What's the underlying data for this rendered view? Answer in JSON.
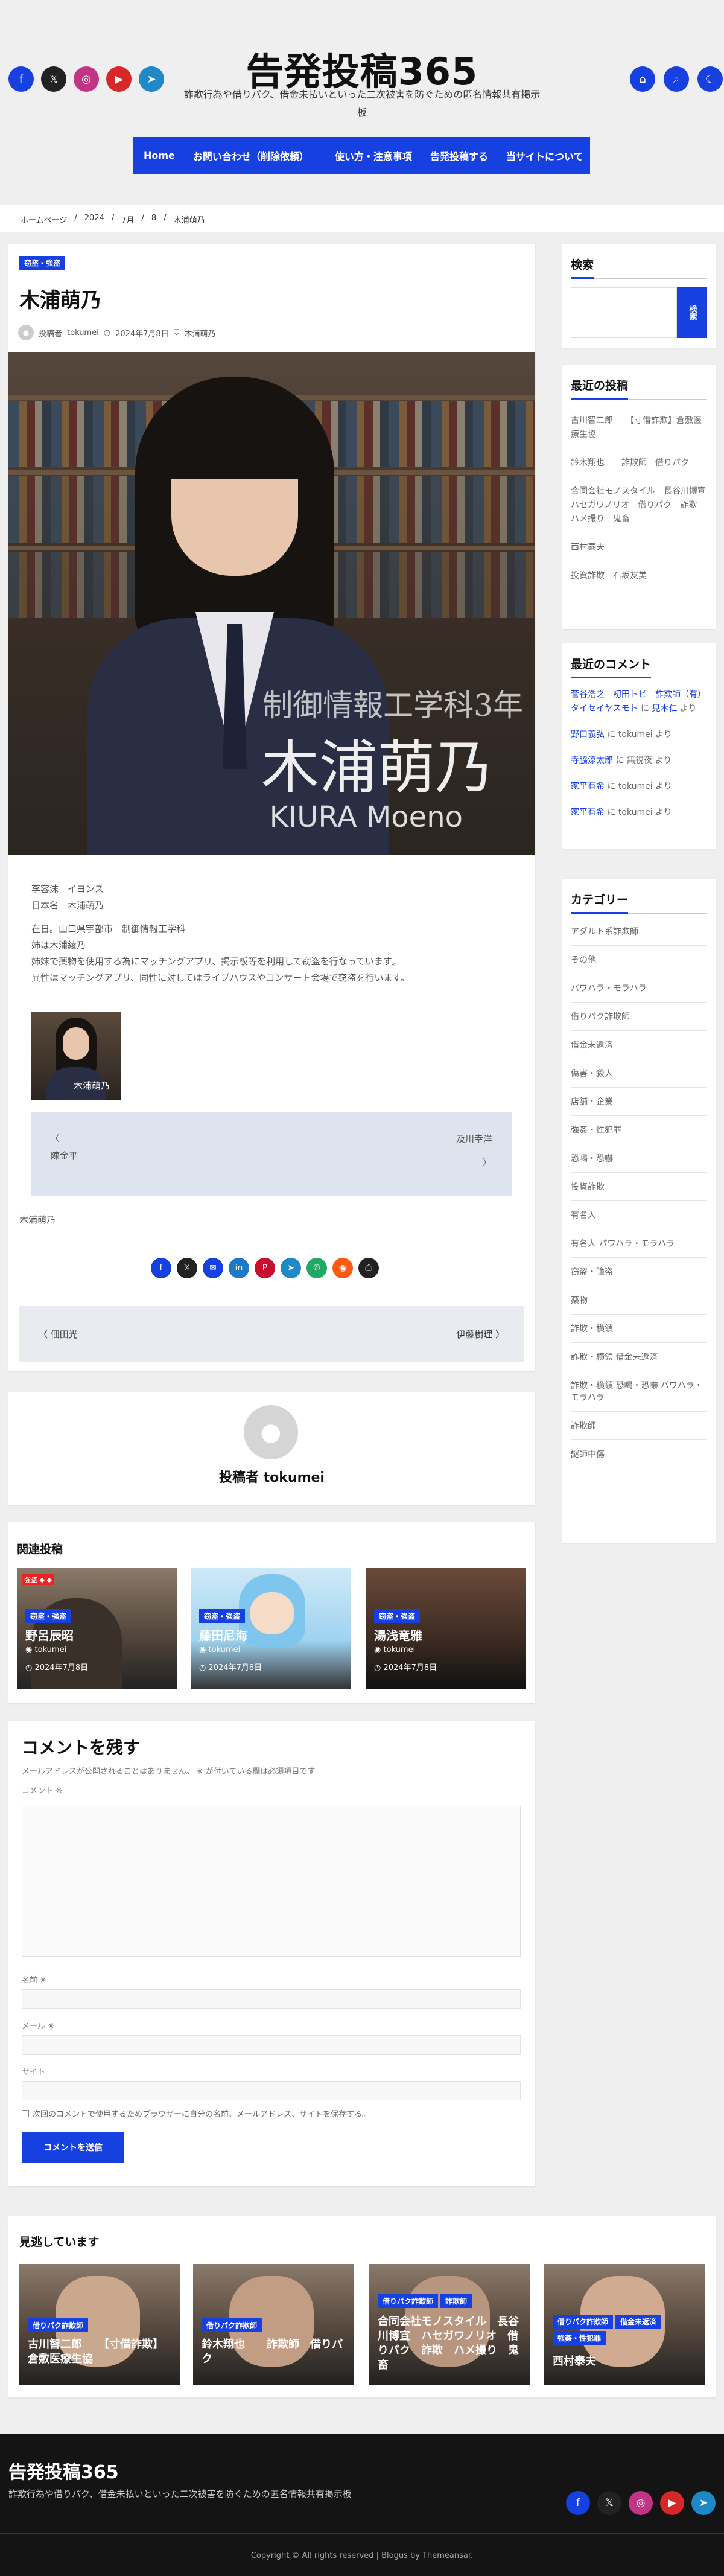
{
  "header": {
    "site_title": "告発投稿365",
    "site_description": "詐欺行為や借りパク、借金未払いといった二次被害を防ぐための匿名情報共有掲示板",
    "social_left": [
      {
        "icon": "facebook-icon",
        "glyph": "f",
        "color": "#1740e0"
      },
      {
        "icon": "x-icon",
        "glyph": "𝕏",
        "color": "#222222"
      },
      {
        "icon": "instagram-icon",
        "glyph": "◎",
        "color": "#c13584"
      },
      {
        "icon": "youtube-icon",
        "glyph": "▶",
        "color": "#d62828"
      },
      {
        "icon": "telegram-icon",
        "glyph": "➤",
        "color": "#1e88c8"
      }
    ],
    "right_icons": [
      {
        "icon": "home-icon",
        "glyph": "⌂"
      },
      {
        "icon": "search-icon",
        "glyph": "⌕"
      },
      {
        "icon": "moon-icon",
        "glyph": "☾"
      }
    ]
  },
  "nav": {
    "items": [
      "Home",
      "お問い合わせ（削除依頼）",
      "使い方・注意事項",
      "告発投稿する",
      "当サイトについて"
    ]
  },
  "breadcrumb": [
    "ホームページ",
    "2024",
    "7月",
    "8",
    "木浦萌乃"
  ],
  "post": {
    "category": "窃盗・強盗",
    "title": "木浦萌乃",
    "author_prefix": "投稿者",
    "author": "tokumei",
    "date": "2024年7月8日",
    "tag": "木浦萌乃",
    "hero_caption_dept": "制御情報工学科3年",
    "hero_caption_name": "木浦萌乃",
    "hero_caption_roman": "KIURA Moeno",
    "body": [
      "李容沫　イヨンス",
      "日本名　木浦萌乃",
      "",
      "在日。山口県宇部市　制御情報工学科",
      "姉は木浦綾乃",
      "姉妹で薬物を使用する為にマッチングアプリ、掲示板等を利用して窃盗を行なっています。",
      "異性はマッチングアプリ、同性に対してはライブハウスやコンサート会場で窃盗を行います。"
    ],
    "thumb_caption": "木浦萌乃",
    "related_box": {
      "left": "陳金平",
      "right": "及川幸洋"
    },
    "footer_tag": "木浦萌乃",
    "share_icons": [
      {
        "icon": "facebook-icon",
        "glyph": "f",
        "color": "#1740e0"
      },
      {
        "icon": "x-icon",
        "glyph": "𝕏",
        "color": "#222222"
      },
      {
        "icon": "mail-icon",
        "glyph": "✉",
        "color": "#1740e0"
      },
      {
        "icon": "linkedin-icon",
        "glyph": "in",
        "color": "#1e78c8"
      },
      {
        "icon": "pinterest-icon",
        "glyph": "P",
        "color": "#c8102e"
      },
      {
        "icon": "telegram-icon",
        "glyph": "➤",
        "color": "#1e88c8"
      },
      {
        "icon": "whatsapp-icon",
        "glyph": "✆",
        "color": "#22a865"
      },
      {
        "icon": "reddit-icon",
        "glyph": "◉",
        "color": "#ff5a12"
      },
      {
        "icon": "print-icon",
        "glyph": "⎙",
        "color": "#222222"
      }
    ],
    "prev": "佃田光",
    "next": "伊藤樹理"
  },
  "author_box": {
    "label": "投稿者 tokumei"
  },
  "related": {
    "heading": "関連投稿",
    "items": [
      {
        "category": "窃盗・強盗",
        "title": "野呂辰昭",
        "author": "tokumei",
        "date": "2024年7月8日"
      },
      {
        "category": "窃盗・強盗",
        "title": "藤田尼海",
        "author": "tokumei",
        "date": "2024年7月8日"
      },
      {
        "category": "窃盗・強盗",
        "title": "湯浅竜雅",
        "author": "tokumei",
        "date": "2024年7月8日"
      }
    ]
  },
  "comment_form": {
    "heading": "コメントを残す",
    "note": "メールアドレスが公開されることはありません。 ※ が付いている欄は必須項目です",
    "comment_label": "コメント ※",
    "name_label": "名前 ※",
    "email_label": "メール ※",
    "site_label": "サイト",
    "save_label": "次回のコメントで使用するためブラウザーに自分の名前、メールアドレス、サイトを保存する。",
    "submit": "コメントを送信"
  },
  "sidebar": {
    "search": {
      "heading": "検索",
      "button": "検索"
    },
    "recent_posts": {
      "heading": "最近の投稿",
      "items": [
        "古川智二郎　　【寸借詐欺】倉敷医療生協",
        "鈴木翔也　　詐欺師　借りパク",
        "合同会社モノスタイル　長谷川博宣　ハセガワノリオ　借りパク　詐欺　ハメ撮り　鬼畜",
        "西村泰夫",
        "投資詐欺　石坂友美"
      ]
    },
    "recent_comments": {
      "heading": "最近のコメント",
      "items": [
        {
          "who": "菅谷浩之　初田トビ　詐欺師（有）タイセイヤスモト",
          "mid": " に ",
          "post": "見木仁",
          "tail": " より"
        },
        {
          "who": "野口義弘",
          "mid": " に ",
          "post": "",
          "tail": "tokumei より"
        },
        {
          "who": "寺脇涼太郎",
          "mid": " に ",
          "post": "",
          "tail": "無視夜 より"
        },
        {
          "who": "家平有希",
          "mid": " に ",
          "post": "",
          "tail": "tokumei より"
        },
        {
          "who": "家平有希",
          "mid": " に ",
          "post": "",
          "tail": "tokumei より"
        }
      ]
    },
    "categories": {
      "heading": "カテゴリー",
      "items": [
        "アダルト系詐欺師",
        "その他",
        "パワハラ・モラハラ",
        "借りパク詐欺師",
        "借金未返済",
        "傷害・殺人",
        "店舗・企業",
        "強姦・性犯罪",
        "恐喝・恐嚇",
        "投資詐欺",
        "有名人",
        "有名人 パワハラ・モラハラ",
        "窃盗・強盗",
        "薬物",
        "詐欺・横領",
        "詐欺・横領 借金未返済",
        "詐欺・横領 恐喝・恐嚇 パワハラ・モラハラ",
        "詐欺師",
        "謎師中傷"
      ]
    }
  },
  "watching": {
    "heading": "見逃しています",
    "items": [
      {
        "categories": [
          "借りパク詐欺師"
        ],
        "title": "古川智二郎　　【寸借詐欺】倉敷医療生協"
      },
      {
        "categories": [
          "借りパク詐欺師"
        ],
        "title": "鈴木翔也　　詐欺師　借りパク"
      },
      {
        "categories": [
          "借りパク詐欺師",
          "詐欺師"
        ],
        "title": "合同会社モノスタイル　長谷川博宣　ハセガワノリオ　借りパク　詐欺　ハメ撮り　鬼畜"
      },
      {
        "categories": [
          "借りパク詐欺師",
          "借金未返済",
          "強姦・性犯罪"
        ],
        "title": "西村泰夫"
      }
    ]
  },
  "footer": {
    "title": "告発投稿365",
    "description": "詐欺行為や借りパク、借金未払いといった二次被害を防ぐための匿名情報共有掲示板",
    "copyright": "Copyright © All rights reserved | Blogus by Themeansar."
  }
}
